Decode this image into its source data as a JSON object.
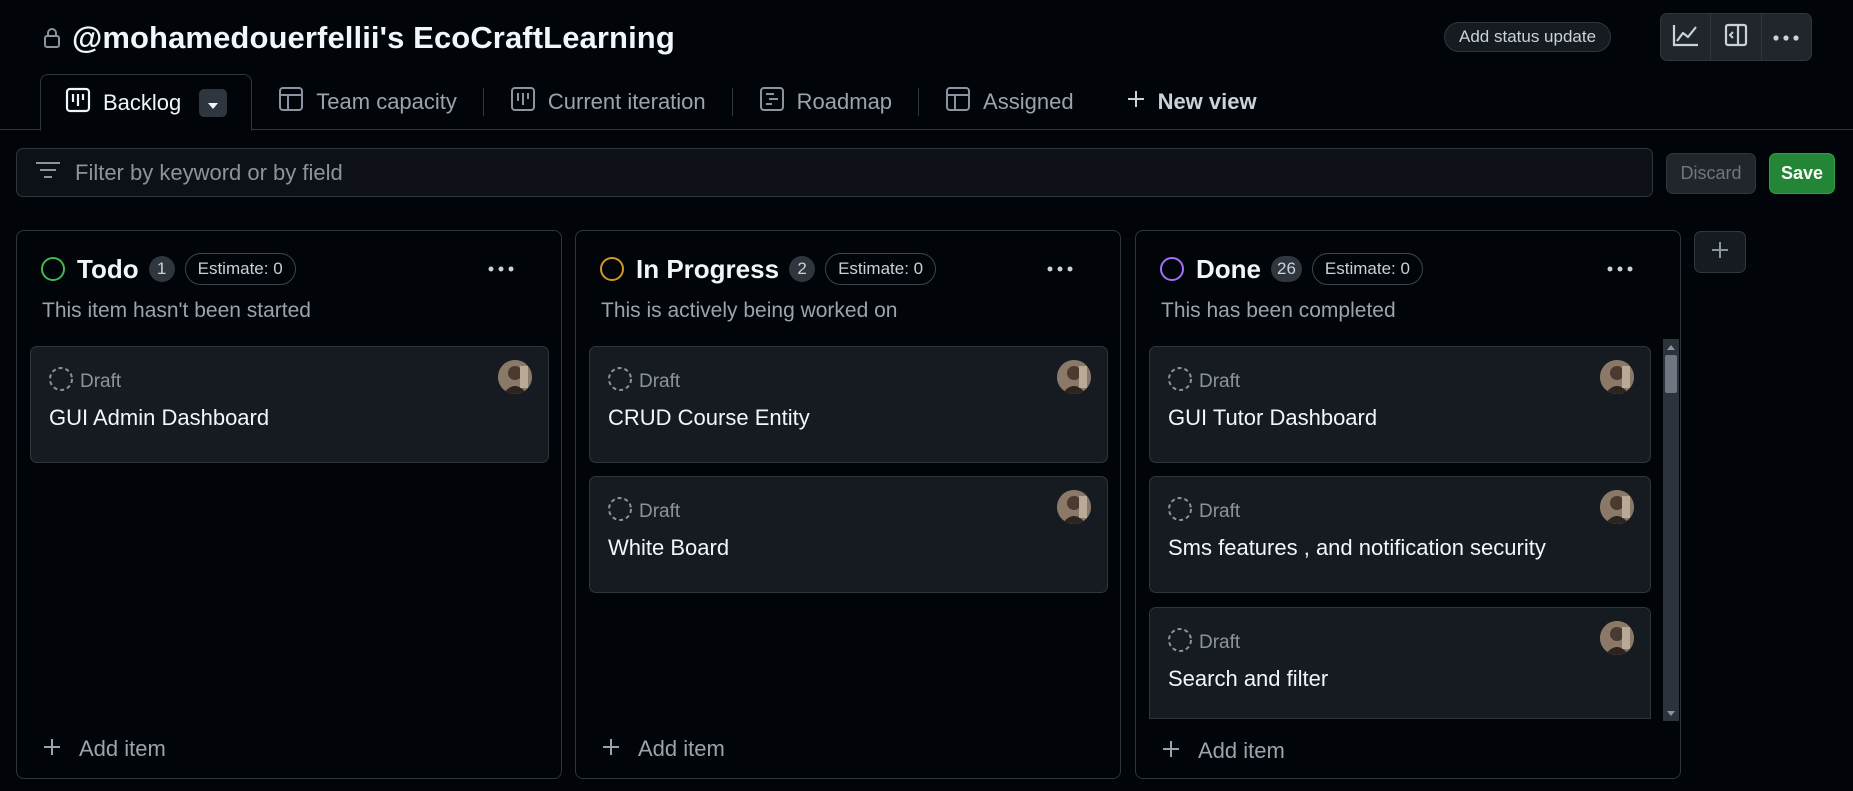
{
  "header": {
    "title": "@mohamedouerfellii's EcoCraftLearning",
    "status_button": "Add status update"
  },
  "tabs": [
    {
      "label": "Backlog",
      "icon": "board-icon",
      "active": true
    },
    {
      "label": "Team capacity",
      "icon": "table-icon"
    },
    {
      "label": "Current iteration",
      "icon": "board-icon"
    },
    {
      "label": "Roadmap",
      "icon": "roadmap-icon"
    },
    {
      "label": "Assigned",
      "icon": "table-icon"
    }
  ],
  "new_view_label": "New view",
  "filter": {
    "placeholder": "Filter by keyword or by field",
    "discard_label": "Discard",
    "save_label": "Save"
  },
  "colors": {
    "todo": "#3fb950",
    "in_progress": "#d29922",
    "done": "#a371f7",
    "save": "#238636"
  },
  "columns": [
    {
      "title": "Todo",
      "count": "1",
      "estimate": "Estimate: 0",
      "description": "This item hasn't been started",
      "cards": [
        {
          "status": "Draft",
          "title": "GUI Admin Dashboard"
        }
      ],
      "add_label": "Add item"
    },
    {
      "title": "In Progress",
      "count": "2",
      "estimate": "Estimate: 0",
      "description": "This is actively being worked on",
      "cards": [
        {
          "status": "Draft",
          "title": "CRUD Course Entity"
        },
        {
          "status": "Draft",
          "title": "White Board"
        }
      ],
      "add_label": "Add item"
    },
    {
      "title": "Done",
      "count": "26",
      "estimate": "Estimate: 0",
      "description": "This has been completed",
      "cards": [
        {
          "status": "Draft",
          "title": "GUI Tutor Dashboard"
        },
        {
          "status": "Draft",
          "title": "Sms features , and notification security"
        },
        {
          "status": "Draft",
          "title": "Search and filter"
        }
      ],
      "add_label": "Add item"
    }
  ]
}
